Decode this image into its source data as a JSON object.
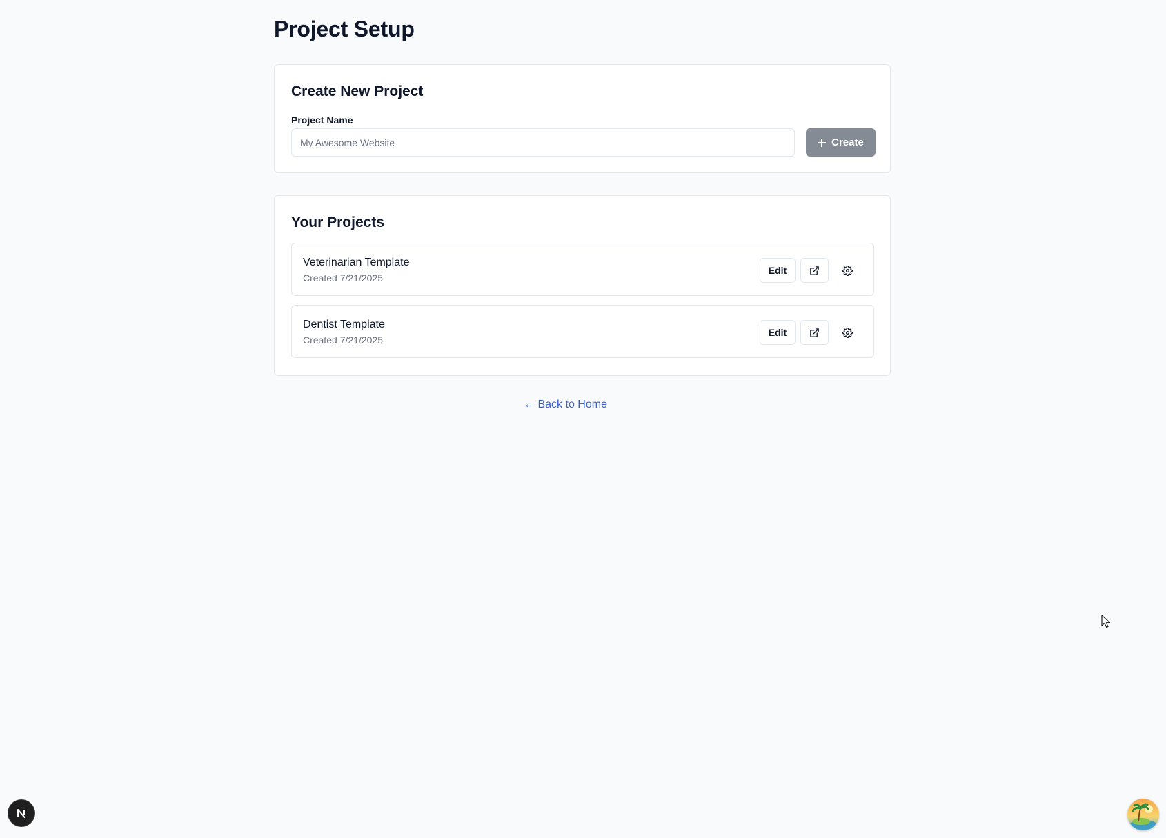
{
  "page": {
    "title": "Project Setup"
  },
  "create": {
    "title": "Create New Project",
    "field_label": "Project Name",
    "input_value": "",
    "input_placeholder": "My Awesome Website",
    "button_label": "Create",
    "button_icon": "plus-icon"
  },
  "projects": {
    "title": "Your Projects",
    "items": [
      {
        "name": "Veterinarian Template",
        "created": "Created 7/21/2025",
        "edit_label": "Edit",
        "open_icon": "external-link-icon",
        "settings_icon": "gear-icon"
      },
      {
        "name": "Dentist Template",
        "created": "Created 7/21/2025",
        "edit_label": "Edit",
        "open_icon": "external-link-icon",
        "settings_icon": "gear-icon"
      }
    ]
  },
  "footer": {
    "back_link": "← Back to Home"
  },
  "overlay": {
    "dev_badge_letter": "N",
    "dev_badge_icon": "nextjs-logo-icon",
    "avatar_icon": "island-avatar-icon"
  },
  "colors": {
    "background": "#f9fafb",
    "card_border": "#e5e7eb",
    "create_button": "#858b95",
    "link": "#3b5fc4",
    "muted_text": "#6b7280"
  }
}
